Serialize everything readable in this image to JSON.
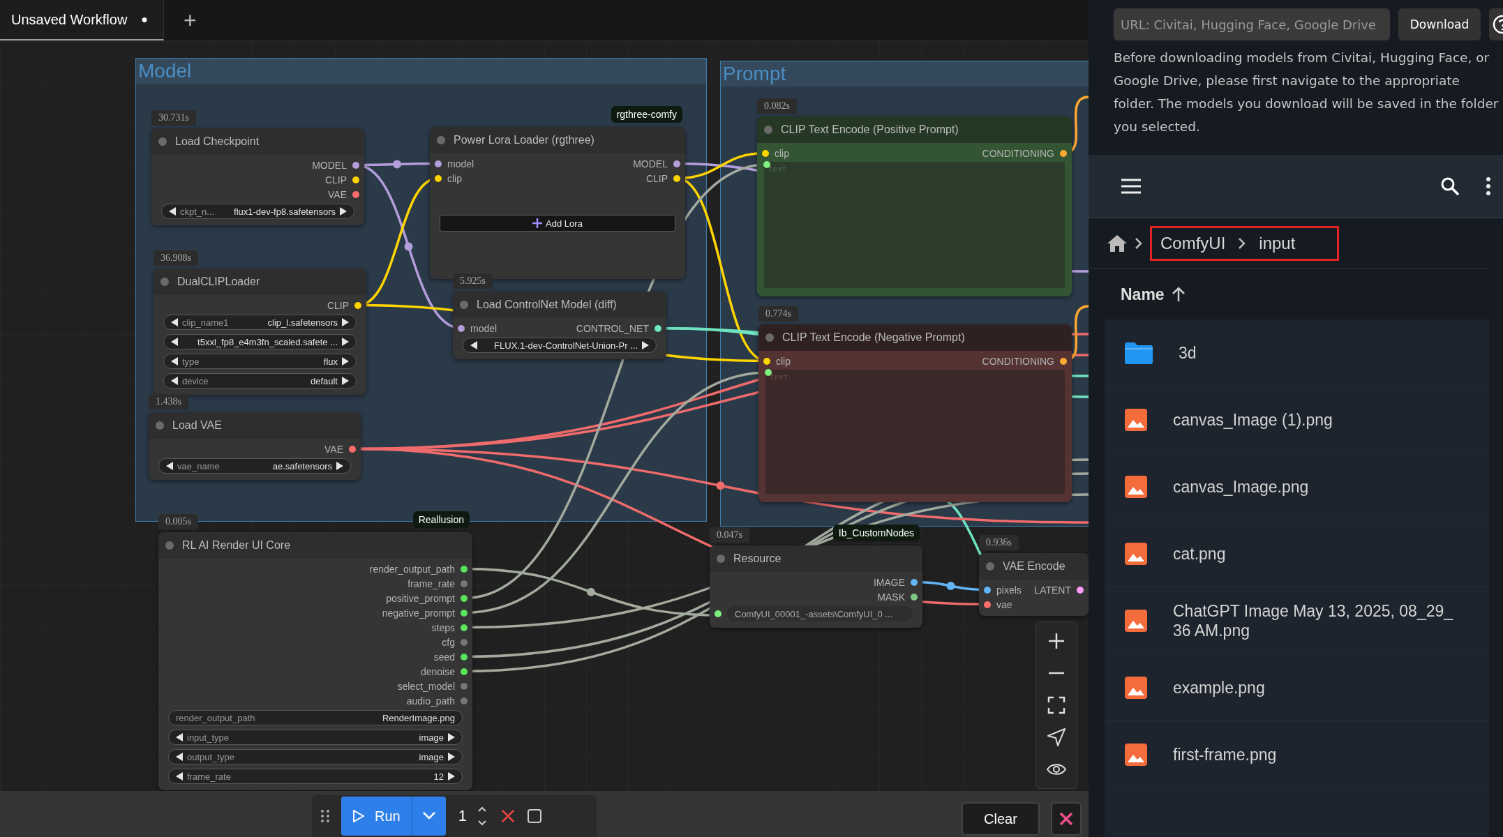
{
  "tabs": [
    {
      "label": "Unsaved Workflow",
      "mark": "●",
      "selected": true
    }
  ],
  "new_tab_button": "+",
  "groups": [
    {
      "title": "Model"
    },
    {
      "title": "Prompt"
    }
  ],
  "nodes": [
    {
      "time": "30.731s",
      "title": "Load Checkpoint",
      "color": "#353535",
      "outputs": [
        {
          "label": "MODEL",
          "color": "#b39ddb"
        },
        {
          "label": "CLIP",
          "color": "#ffd500"
        },
        {
          "label": "VAE",
          "color": "#ff6e6e"
        }
      ],
      "widgets": [
        {
          "kind": "combo",
          "label": "ckpt_n...",
          "value": "flux1-dev-fp8.safetensors"
        }
      ]
    },
    {
      "badge": "rgthree-comfy",
      "title": "Power Lora Loader (rgthree)",
      "color": "#353535",
      "inputs": [
        {
          "label": "model",
          "color": "#b39ddb"
        },
        {
          "label": "clip",
          "color": "#ffd500"
        }
      ],
      "outputs": [
        {
          "label": "MODEL",
          "color": "#b39ddb"
        },
        {
          "label": "CLIP",
          "color": "#ffd500"
        }
      ],
      "widgets": [
        {
          "kind": "button",
          "label": "Add Lora"
        }
      ]
    },
    {
      "time": "36.908s",
      "title": "DualCLIPLoader",
      "color": "#353535",
      "outputs": [
        {
          "label": "CLIP",
          "color": "#ffd500"
        }
      ],
      "widgets": [
        {
          "kind": "combo",
          "label": "clip_name1",
          "value": "clip_l.safetensors"
        },
        {
          "kind": "combo",
          "value": "t5xxl_fp8_e4m3fn_scaled.safete ..."
        },
        {
          "kind": "combo",
          "label": "type",
          "value": "flux"
        },
        {
          "kind": "combo",
          "label": "device",
          "value": "default"
        }
      ]
    },
    {
      "time": "1.438s",
      "title": "Load VAE",
      "color": "#353535",
      "outputs": [
        {
          "label": "VAE",
          "color": "#ff6e6e"
        }
      ],
      "widgets": [
        {
          "kind": "combo",
          "label": "vae_name",
          "value": "ae.safetensors"
        }
      ]
    },
    {
      "time": "5.925s",
      "title": "Load ControlNet Model (diff)",
      "color": "#353535",
      "inputs": [
        {
          "label": "model",
          "color": "#b39ddb"
        }
      ],
      "outputs": [
        {
          "label": "CONTROL_NET",
          "color": "#6ee7c3"
        }
      ],
      "widgets": [
        {
          "kind": "combo",
          "value": "FLUX.1-dev-ControlNet-Union-Pr ..."
        }
      ]
    },
    {
      "time": "0.082s",
      "title": "CLIP Text Encode (Positive Prompt)",
      "color": "#335533",
      "inputs": [
        {
          "label": "clip",
          "color": "#ffd500"
        }
      ],
      "outputs": [
        {
          "label": "CONDITIONING",
          "color": "#ffa931"
        }
      ],
      "widgets": [
        {
          "kind": "textarea",
          "placeholder": "text",
          "color": "#7ef07e"
        }
      ]
    },
    {
      "time": "0.774s",
      "title": "CLIP Text Encode (Negative Prompt)",
      "color": "#553333",
      "inputs": [
        {
          "label": "clip",
          "color": "#ffd500"
        }
      ],
      "outputs": [
        {
          "label": "CONDITIONING",
          "color": "#ffa931"
        }
      ],
      "widgets": [
        {
          "kind": "textarea",
          "placeholder": "text",
          "color": "#7ef07e"
        }
      ]
    },
    {
      "time": "0.005s",
      "badge": "Reallusion",
      "title": "RL AI Render UI Core",
      "color": "#353535",
      "outputs": [
        {
          "label": "render_output_path",
          "color": "#5be35b"
        },
        {
          "label": "frame_rate",
          "color": "#777777"
        },
        {
          "label": "positive_prompt",
          "color": "#5be35b"
        },
        {
          "label": "negative_prompt",
          "color": "#5be35b"
        },
        {
          "label": "steps",
          "color": "#5be35b"
        },
        {
          "label": "cfg",
          "color": "#777777"
        },
        {
          "label": "seed",
          "color": "#5be35b"
        },
        {
          "label": "denoise",
          "color": "#5be35b"
        },
        {
          "label": "select_model",
          "color": "#777777"
        },
        {
          "label": "audio_path",
          "color": "#777777"
        }
      ],
      "widgets": [
        {
          "kind": "text",
          "label": "render_output_path",
          "value": "RenderImage.png"
        },
        {
          "kind": "combo",
          "label": "input_type",
          "value": "image"
        },
        {
          "kind": "combo",
          "label": "output_type",
          "value": "image"
        },
        {
          "kind": "combo",
          "label": "frame_rate",
          "value": "12"
        }
      ]
    },
    {
      "time": "0.047s",
      "badge": "Ib_CustomNodes",
      "title": "Resource",
      "color": "#353535",
      "outputs": [
        {
          "label": "IMAGE",
          "color": "#64b5f6"
        },
        {
          "label": "MASK",
          "color": "#81c784"
        }
      ],
      "widgets": [
        {
          "kind": "text",
          "value": "ComfyUI_00001_-assets\\ComfyUI_0 ...",
          "color": "#7ef07e"
        }
      ]
    },
    {
      "time": "0.936s",
      "title": "VAE Encode",
      "color": "#353535",
      "inputs": [
        {
          "label": "pixels",
          "color": "#64b5f6"
        },
        {
          "label": "vae",
          "color": "#ff6e6e"
        }
      ],
      "outputs": [
        {
          "label": "LATENT",
          "color": "#ff9cf9"
        }
      ]
    }
  ],
  "run_toolbar": {
    "run_button": "Run",
    "count": "1"
  },
  "clear_button": "Clear",
  "side_panel": {
    "url_field": {
      "placeholder": "URL: Civitai, Hugging Face, Google Drive"
    },
    "download_button": "Download",
    "info": "Before downloading models from Civitai, Hugging Face, or Google Drive, please first navigate to the appropriate folder. The models you download will be saved in the folder you selected.",
    "breadcrumb": {
      "highlighted": true,
      "items": [
        {
          "label": "ComfyUI"
        },
        {
          "label": "input"
        }
      ]
    },
    "sort_header": {
      "label": "Name"
    },
    "files": [
      {
        "name": "3d",
        "kind": "folder"
      },
      {
        "name": "canvas_Image (1).png",
        "kind": "image"
      },
      {
        "name": "canvas_Image.png",
        "kind": "image"
      },
      {
        "name": "cat.png",
        "kind": "image"
      },
      {
        "name": "ChatGPT Image May 13, 2025, 08_29_36 AM.png",
        "kind": "image"
      },
      {
        "name": "example.png",
        "kind": "image"
      },
      {
        "name": "first-frame.png",
        "kind": "image"
      }
    ]
  }
}
